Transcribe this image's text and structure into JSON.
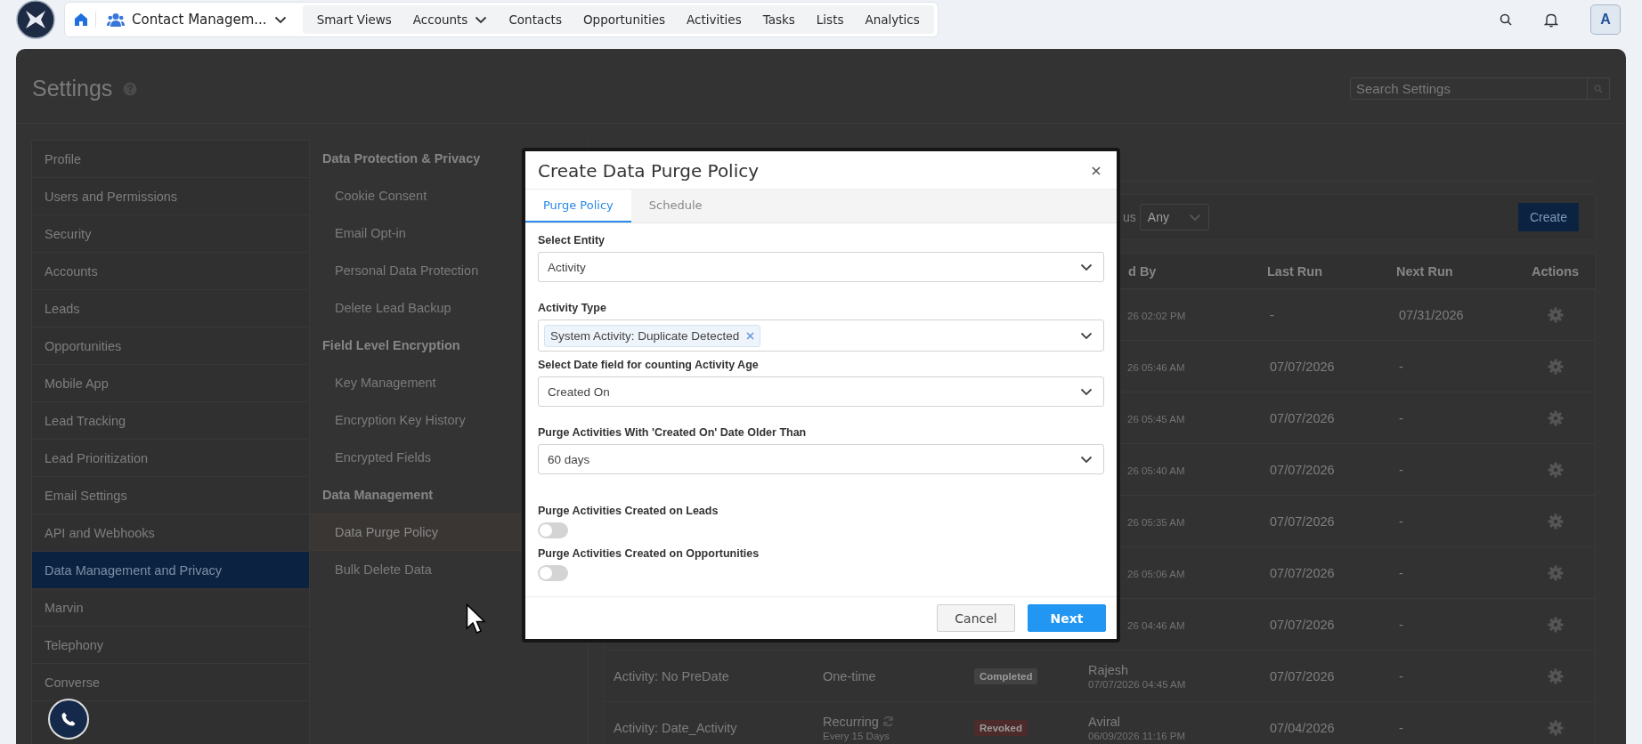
{
  "topbar": {
    "app_switcher": "Contact Managem...",
    "nav": [
      {
        "label": "Smart Views",
        "has_menu": false
      },
      {
        "label": "Accounts",
        "has_menu": true
      },
      {
        "label": "Contacts",
        "has_menu": false
      },
      {
        "label": "Opportunities",
        "has_menu": false
      },
      {
        "label": "Activities",
        "has_menu": false
      },
      {
        "label": "Tasks",
        "has_menu": false
      },
      {
        "label": "Lists",
        "has_menu": false
      },
      {
        "label": "Analytics",
        "has_menu": false
      }
    ],
    "avatar": "A"
  },
  "settings": {
    "title": "Settings",
    "search": {
      "placeholder": "Search Settings"
    },
    "sidebar": {
      "items": [
        {
          "label": "Profile",
          "selected": false
        },
        {
          "label": "Users and Permissions",
          "selected": false
        },
        {
          "label": "Security",
          "selected": false
        },
        {
          "label": "Accounts",
          "selected": false
        },
        {
          "label": "Leads",
          "selected": false
        },
        {
          "label": "Opportunities",
          "selected": false
        },
        {
          "label": "Mobile App",
          "selected": false
        },
        {
          "label": "Lead Tracking",
          "selected": false
        },
        {
          "label": "Lead Prioritization",
          "selected": false
        },
        {
          "label": "Email Settings",
          "selected": false
        },
        {
          "label": "API and Webhooks",
          "selected": false
        },
        {
          "label": "Data Management and Privacy",
          "selected": true
        },
        {
          "label": "Marvin",
          "selected": false
        },
        {
          "label": "Telephony",
          "selected": false
        },
        {
          "label": "Converse",
          "selected": false
        }
      ]
    },
    "subnav": [
      {
        "header": "Data Protection & Privacy",
        "items": [
          {
            "label": "Cookie Consent",
            "selected": false
          },
          {
            "label": "Email Opt-in",
            "selected": false
          },
          {
            "label": "Personal Data Protection",
            "selected": false
          },
          {
            "label": "Delete Lead Backup",
            "selected": false
          }
        ]
      },
      {
        "header": "Field Level Encryption",
        "items": [
          {
            "label": "Key Management",
            "selected": false
          },
          {
            "label": "Encryption Key History",
            "selected": false
          },
          {
            "label": "Encrypted Fields",
            "selected": false
          }
        ]
      },
      {
        "header": "Data Management",
        "items": [
          {
            "label": "Data Purge Policy",
            "selected": true
          },
          {
            "label": "Bulk Delete Data",
            "selected": false
          }
        ]
      }
    ],
    "filter": {
      "label": "us",
      "value": "Any",
      "create_button": "Create"
    },
    "table": {
      "columns": [
        "d By",
        "Last Run",
        "Next Run",
        "Actions"
      ],
      "rows": [
        {
          "created_on": "26 02:02 PM",
          "last_run": "-",
          "next_run": "07/31/2026"
        },
        {
          "created_on": "26 05:46 AM",
          "last_run": "07/07/2026",
          "next_run": "-"
        },
        {
          "created_on": "26 05:45 AM",
          "last_run": "07/07/2026",
          "next_run": "-"
        },
        {
          "created_on": "26 05:40 AM",
          "last_run": "07/07/2026",
          "next_run": "-"
        },
        {
          "created_on": "26 05:35 AM",
          "last_run": "07/07/2026",
          "next_run": "-"
        },
        {
          "created_on": "26 05:06 AM",
          "last_run": "07/07/2026",
          "next_run": "-"
        },
        {
          "created_on": "26 04:46 AM",
          "last_run": "07/07/2026",
          "next_run": "-"
        },
        {
          "name": "Activity: No PreDate",
          "type": "One-time",
          "recurring": false,
          "status": {
            "label": "Completed",
            "color": "#424242"
          },
          "created_by": "Rajesh",
          "created_on": "07/07/2026 04:45 AM",
          "last_run": "07/07/2026",
          "next_run": "-"
        },
        {
          "name": "Activity: Date_Activity",
          "type": "Recurring",
          "recurring": true,
          "type_detail": "Every 15 Days",
          "status": {
            "label": "Revoked",
            "color": "#4d2b2b"
          },
          "created_by": "Aviral",
          "created_on": "06/09/2026 11:16 PM",
          "last_run": "07/04/2026",
          "next_run": "-"
        }
      ]
    }
  },
  "modal": {
    "title": "Create Data Purge Policy",
    "tabs": [
      {
        "label": "Purge Policy",
        "selected": true
      },
      {
        "label": "Schedule",
        "selected": false
      }
    ],
    "fields": [
      {
        "kind": "select",
        "label": "Select Entity",
        "value": "Activity"
      },
      {
        "kind": "multiselect",
        "label": "Activity Type",
        "chips": [
          "System Activity: Duplicate Detected"
        ]
      },
      {
        "kind": "select",
        "label": "Select Date field for counting Activity Age",
        "value": "Created On"
      },
      {
        "kind": "select",
        "label": "Purge Activities With 'Created On' Date Older Than",
        "value": "60 days"
      },
      {
        "kind": "toggle",
        "label": "Purge Activities Created on Leads",
        "on": false
      },
      {
        "kind": "toggle",
        "label": "Purge Activities Created on Opportunities",
        "on": false
      }
    ],
    "buttons": [
      {
        "label": "Cancel",
        "kind": "secondary"
      },
      {
        "label": "Next",
        "kind": "primary"
      }
    ]
  }
}
